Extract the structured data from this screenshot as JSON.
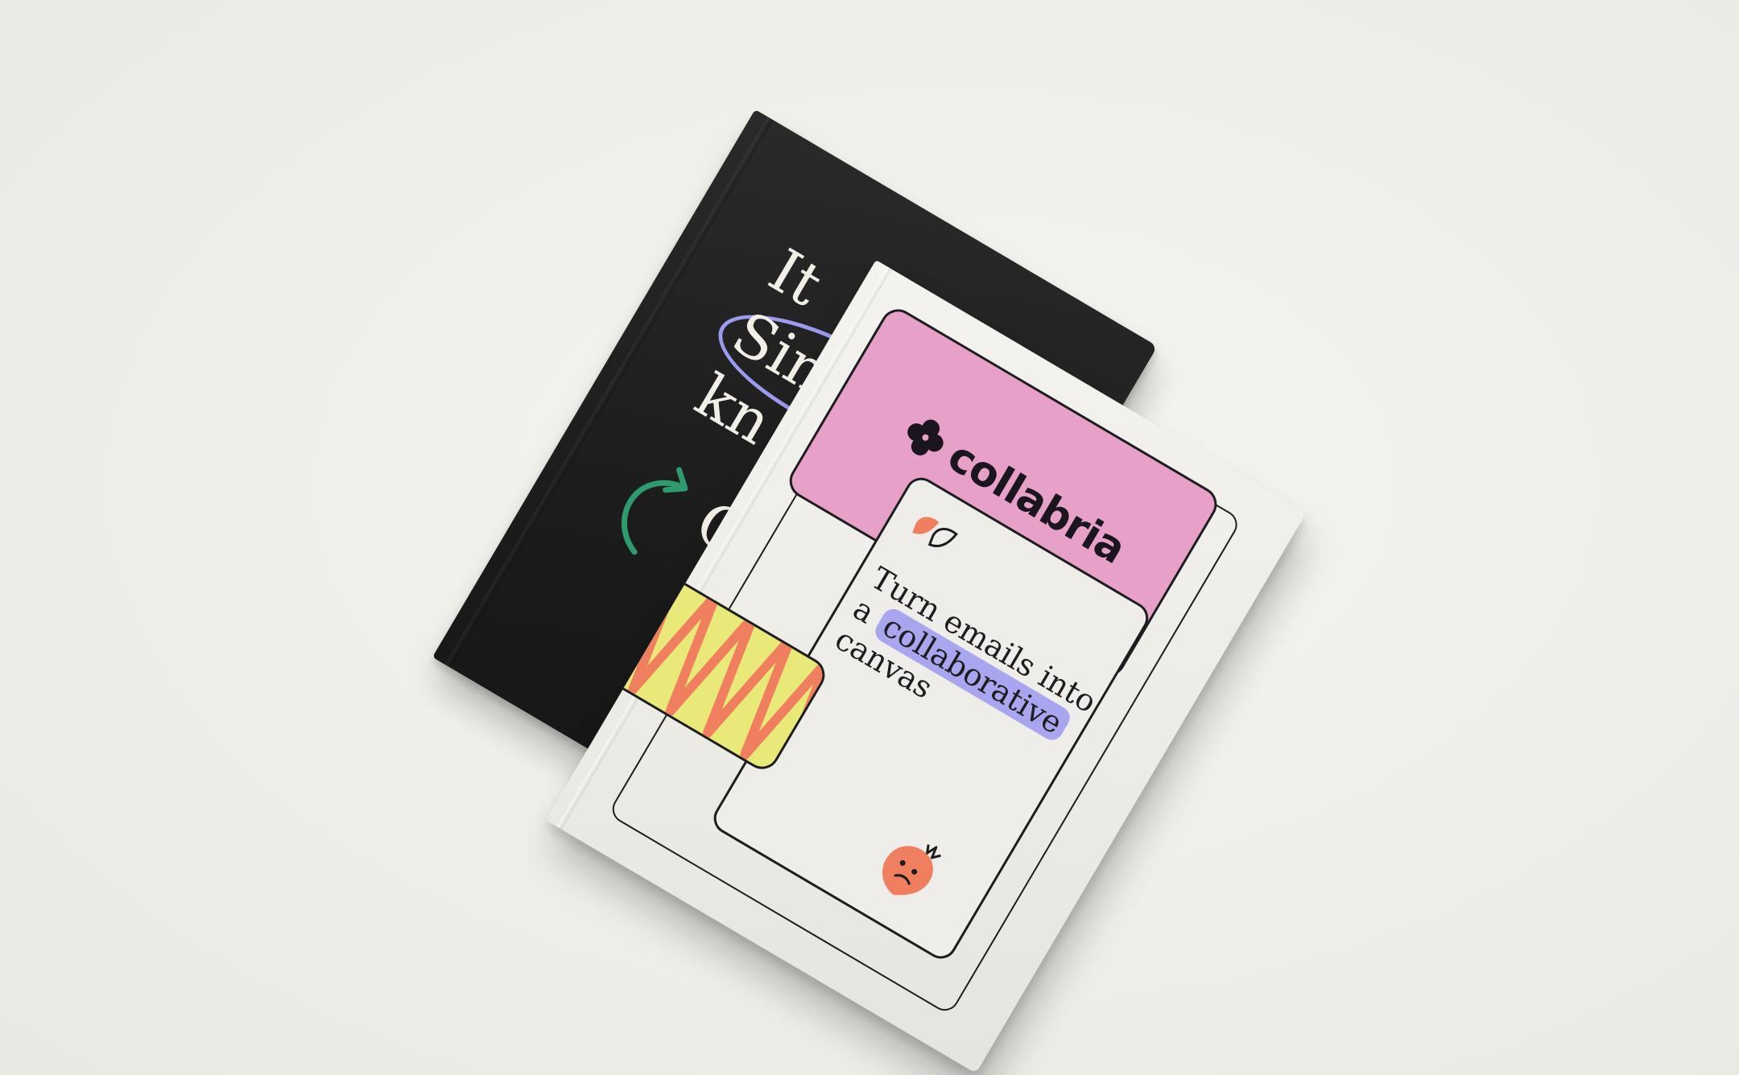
{
  "scene": {
    "background": "#f1efea"
  },
  "back_book": {
    "cover_color": "#1c1c1c",
    "title_fragment": "It\nSin\nkn",
    "lower_fragment": "O",
    "accent_oval_color": "#9d9bf0",
    "accent_arrow_color": "#2e9b6e"
  },
  "front_book": {
    "cover_color": "#eeede9",
    "brand": {
      "name": "collabria",
      "icon": "flower-logo-icon",
      "card_color": "#e7a0c8"
    },
    "headline": {
      "line1": "Turn emails into",
      "line2_prefix": "a",
      "line2_highlight": "collaborative",
      "line3": "canvas",
      "highlight_color": "#a9a6ef"
    },
    "decor": {
      "drops_icon": "speech-drops-icon",
      "mascot_icon": "angry-blob-mascot-icon",
      "pattern_card_color": "#e8e979",
      "pattern_color": "#ef7f5f"
    }
  }
}
